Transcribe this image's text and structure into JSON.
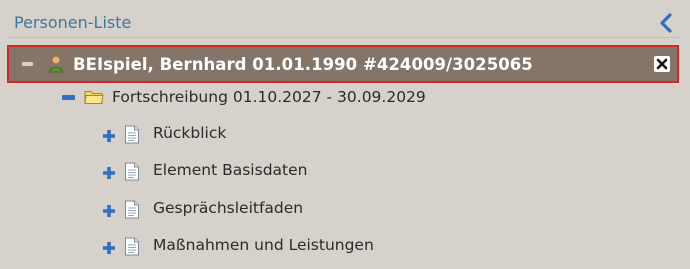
{
  "panel": {
    "title": "Personen-Liste",
    "collapse_icon": "chevron-left-icon"
  },
  "person": {
    "label": "BEIspiel, Bernhard 01.01.1990 #424009/3025065",
    "expanded": true,
    "icon": "person-icon",
    "close_icon": "close-icon"
  },
  "tree": {
    "period": {
      "label": "Fortschreibung 01.10.2027 - 30.09.2029",
      "expanded": true,
      "icon": "folder-icon"
    },
    "items": [
      {
        "label": "Rückblick",
        "expanded": false,
        "icon": "document-icon"
      },
      {
        "label": "Element Basisdaten",
        "expanded": false,
        "icon": "document-icon"
      },
      {
        "label": "Gesprächsleitfaden",
        "expanded": false,
        "icon": "document-icon"
      },
      {
        "label": "Maßnahmen und Leistungen",
        "expanded": false,
        "icon": "document-icon"
      }
    ]
  },
  "colors": {
    "accent": "#3c7a96",
    "selection_border": "#d42626",
    "selection_bg": "#857569",
    "tree_icon_blue": "#2f6fc4",
    "background": "#d6d1ca"
  }
}
